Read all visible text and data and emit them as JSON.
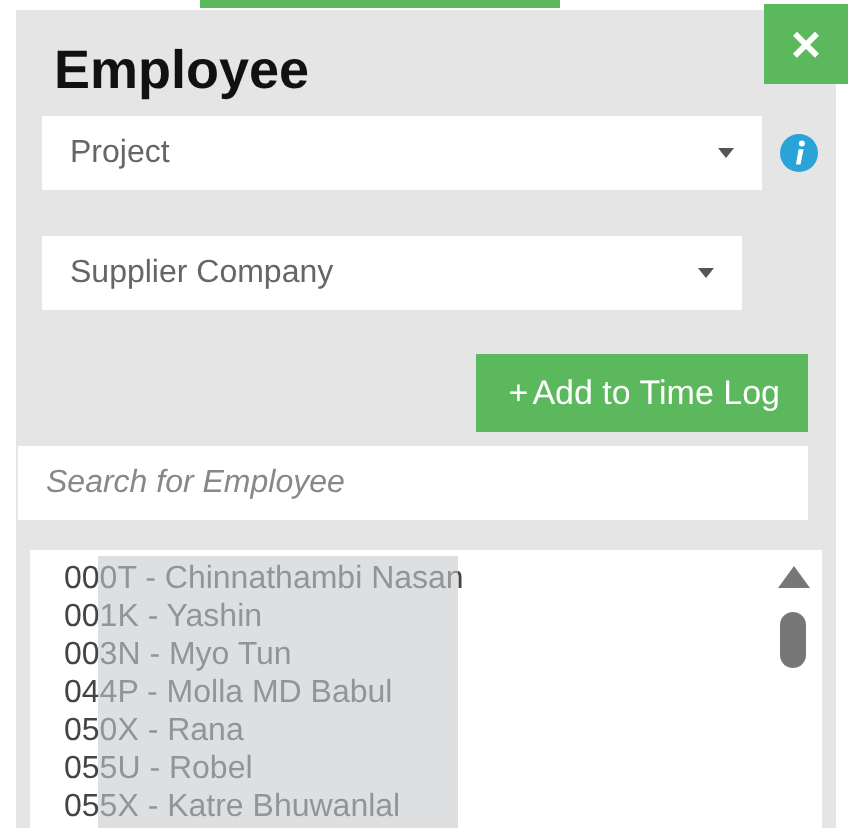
{
  "dialog": {
    "title": "Employee",
    "close_label": "×"
  },
  "selects": [
    {
      "value": "Project",
      "info": true
    },
    {
      "value": "Supplier Company",
      "info": false
    }
  ],
  "add_button": {
    "icon": "+",
    "label": "Add to Time Log"
  },
  "search": {
    "placeholder": "Search for Employee"
  },
  "employees": [
    "000T - Chinnathambi Nasan",
    "001K - Yashin",
    "003N - Myo Tun",
    "044P - Molla MD Babul",
    "050X - Rana",
    "055U - Robel",
    "055X - Katre Bhuwanlal"
  ]
}
